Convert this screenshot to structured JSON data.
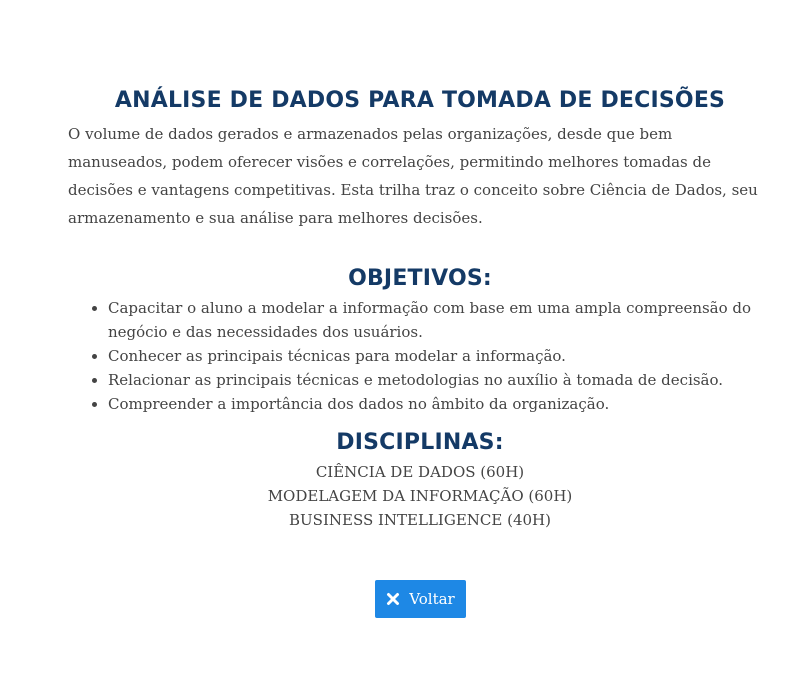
{
  "title": "ANÁLISE DE DADOS PARA TOMADA DE DECISÕES",
  "intro": "O volume de dados gerados e armazenados pelas organizações, desde que bem manuseados, podem oferecer visões e correlações, permitindo melhores tomadas de decisões e vantagens competitivas. Esta trilha traz o conceito sobre Ciência de Dados, seu armazenamento e sua análise para melhores decisões.",
  "objectives": {
    "title": "OBJETIVOS:",
    "items": [
      "Capacitar o aluno a modelar a informação com base em uma ampla compreensão do negócio e das necessidades dos usuários.",
      "Conhecer as principais técnicas para modelar a informação.",
      "Relacionar as principais técnicas e metodologias no auxílio à tomada de decisão.",
      "Compreender a importância dos dados no âmbito da organização."
    ]
  },
  "disciplines": {
    "title": "DISCIPLINAS:",
    "items": [
      "CIÊNCIA DE DADOS (60H)",
      "MODELAGEM DA INFORMAÇÃO (60H)",
      "BUSINESS INTELLIGENCE (40H)"
    ]
  },
  "back_button": {
    "label": "Voltar",
    "icon": "close-icon"
  },
  "colors": {
    "heading": "#143a66",
    "body_text": "#444444",
    "button_bg": "#1e88e5",
    "button_text": "#ffffff"
  }
}
